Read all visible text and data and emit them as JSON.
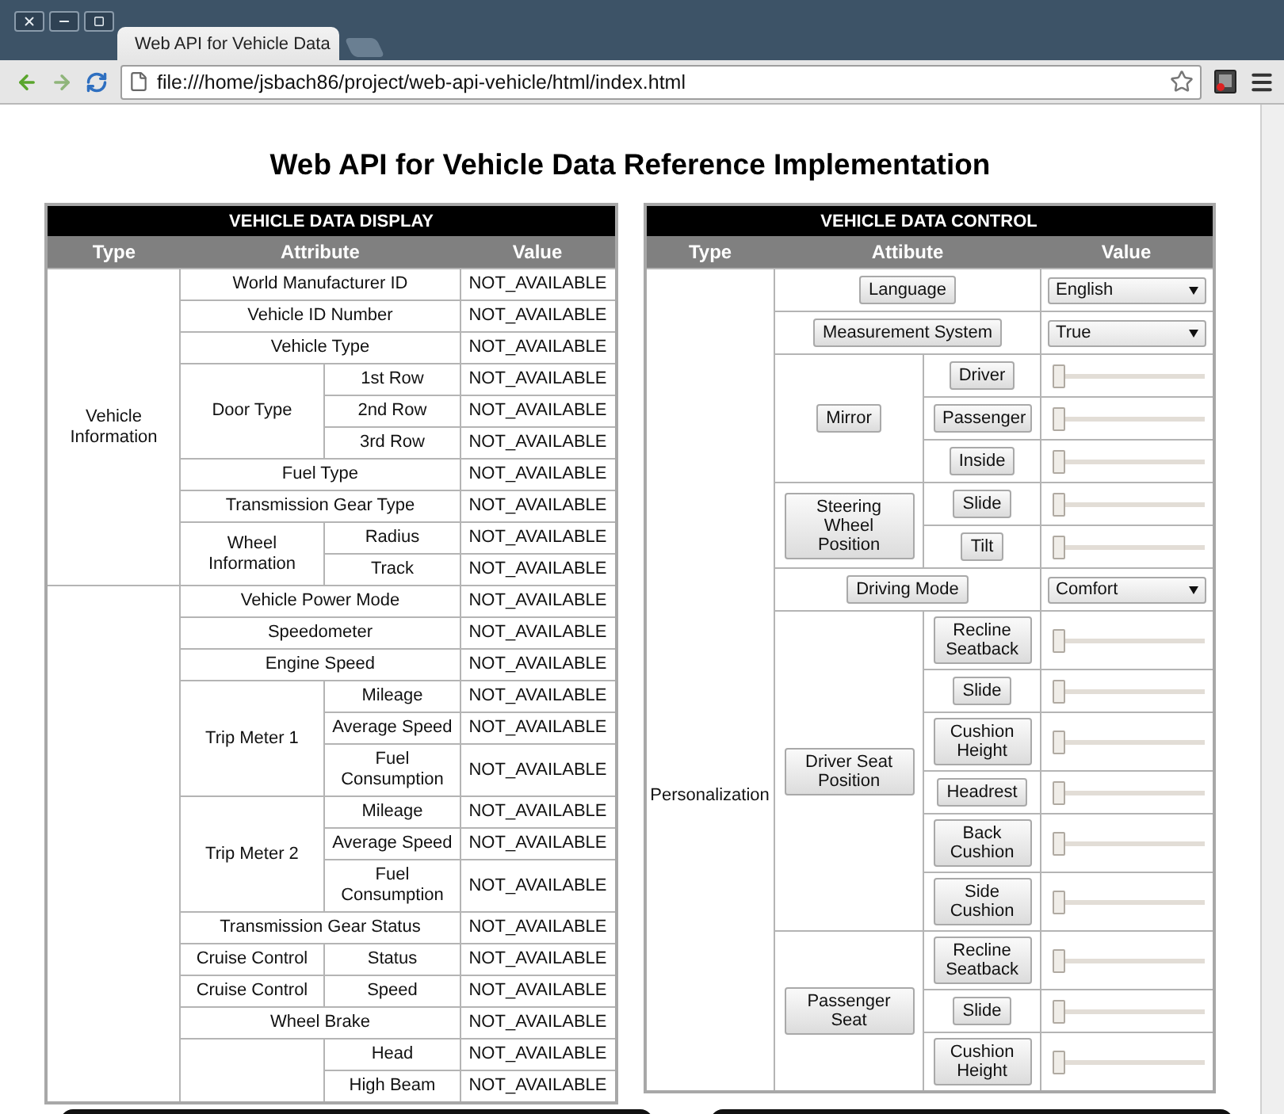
{
  "browser": {
    "tab_title": "Web API for Vehicle Data",
    "url": "file:///home/jsbach86/project/web-api-vehicle/html/index.html"
  },
  "page_title": "Web API for Vehicle Data Reference Implementation",
  "display": {
    "title": "VEHICLE DATA DISPLAY",
    "columns": [
      "Type",
      "Attribute",
      "Value"
    ],
    "groups": [
      {
        "type": "Vehicle Information",
        "items": [
          {
            "attribute": "World Manufacturer ID",
            "value": "NOT_AVAILABLE"
          },
          {
            "attribute": "Vehicle ID Number",
            "value": "NOT_AVAILABLE"
          },
          {
            "attribute": "Vehicle Type",
            "value": "NOT_AVAILABLE"
          },
          {
            "attribute": "Door Type",
            "children": [
              {
                "attribute": "1st Row",
                "value": "NOT_AVAILABLE"
              },
              {
                "attribute": "2nd Row",
                "value": "NOT_AVAILABLE"
              },
              {
                "attribute": "3rd Row",
                "value": "NOT_AVAILABLE"
              }
            ]
          },
          {
            "attribute": "Fuel Type",
            "value": "NOT_AVAILABLE"
          },
          {
            "attribute": "Transmission Gear Type",
            "value": "NOT_AVAILABLE"
          },
          {
            "attribute": "Wheel Information",
            "children": [
              {
                "attribute": "Radius",
                "value": "NOT_AVAILABLE"
              },
              {
                "attribute": "Track",
                "value": "NOT_AVAILABLE"
              }
            ]
          }
        ]
      },
      {
        "items": [
          {
            "attribute": "Vehicle Power Mode",
            "value": "NOT_AVAILABLE"
          },
          {
            "attribute": "Speedometer",
            "value": "NOT_AVAILABLE"
          },
          {
            "attribute": "Engine Speed",
            "value": "NOT_AVAILABLE"
          },
          {
            "attribute": "Trip Meter 1",
            "children": [
              {
                "attribute": "Mileage",
                "value": "NOT_AVAILABLE"
              },
              {
                "attribute": "Average Speed",
                "value": "NOT_AVAILABLE"
              },
              {
                "attribute": "Fuel Consumption",
                "value": "NOT_AVAILABLE"
              }
            ]
          },
          {
            "attribute": "Trip Meter 2",
            "children": [
              {
                "attribute": "Mileage",
                "value": "NOT_AVAILABLE"
              },
              {
                "attribute": "Average Speed",
                "value": "NOT_AVAILABLE"
              },
              {
                "attribute": "Fuel Consumption",
                "value": "NOT_AVAILABLE"
              }
            ]
          },
          {
            "attribute": "Transmission Gear Status",
            "value": "NOT_AVAILABLE"
          },
          {
            "attribute": "Cruise Control",
            "children": [
              {
                "attribute": "Status",
                "value": "NOT_AVAILABLE"
              }
            ]
          },
          {
            "attribute": "Cruise Control",
            "children": [
              {
                "attribute": "Speed",
                "value": "NOT_AVAILABLE"
              }
            ]
          },
          {
            "attribute": "Wheel Brake",
            "value": "NOT_AVAILABLE"
          },
          {
            "children": [
              {
                "attribute": "Head",
                "value": "NOT_AVAILABLE"
              },
              {
                "attribute": "High Beam",
                "value": "NOT_AVAILABLE"
              }
            ]
          }
        ]
      }
    ]
  },
  "control": {
    "title": "VEHICLE DATA CONTROL",
    "columns": [
      "Type",
      "Attibute",
      "Value"
    ],
    "groups": [
      {
        "type": "Personalization",
        "items": [
          {
            "label": "Language",
            "control": {
              "kind": "select",
              "value": "English"
            }
          },
          {
            "label": "Measurement System",
            "control": {
              "kind": "select",
              "value": "True"
            }
          },
          {
            "label": "Mirror",
            "children": [
              {
                "label": "Driver",
                "control": {
                  "kind": "slider",
                  "level": 0
                }
              },
              {
                "label": "Passenger",
                "control": {
                  "kind": "slider",
                  "level": 0
                }
              },
              {
                "label": "Inside",
                "control": {
                  "kind": "slider",
                  "level": 0
                }
              }
            ]
          },
          {
            "label": "Steering Wheel Position",
            "children": [
              {
                "label": "Slide",
                "control": {
                  "kind": "slider",
                  "level": 0
                }
              },
              {
                "label": "Tilt",
                "control": {
                  "kind": "slider",
                  "level": 0
                }
              }
            ]
          },
          {
            "label": "Driving Mode",
            "control": {
              "kind": "select",
              "value": "Comfort"
            }
          },
          {
            "label": "Driver Seat Position",
            "children": [
              {
                "label": "Recline Seatback",
                "control": {
                  "kind": "slider",
                  "level": 0
                }
              },
              {
                "label": "Slide",
                "control": {
                  "kind": "slider",
                  "level": 0
                }
              },
              {
                "label": "Cushion Height",
                "control": {
                  "kind": "slider",
                  "level": 0
                }
              },
              {
                "label": "Headrest",
                "control": {
                  "kind": "slider",
                  "level": 0
                }
              },
              {
                "label": "Back Cushion",
                "control": {
                  "kind": "slider",
                  "level": 0
                }
              },
              {
                "label": "Side Cushion",
                "control": {
                  "kind": "slider",
                  "level": 0
                }
              }
            ]
          },
          {
            "label": "Passenger Seat",
            "children": [
              {
                "label": "Recline Seatback",
                "control": {
                  "kind": "slider",
                  "level": 0
                }
              },
              {
                "label": "Slide",
                "control": {
                  "kind": "slider",
                  "level": 0
                }
              },
              {
                "label": "Cushion Height",
                "control": {
                  "kind": "slider",
                  "level": 0
                }
              }
            ]
          }
        ]
      }
    ]
  }
}
